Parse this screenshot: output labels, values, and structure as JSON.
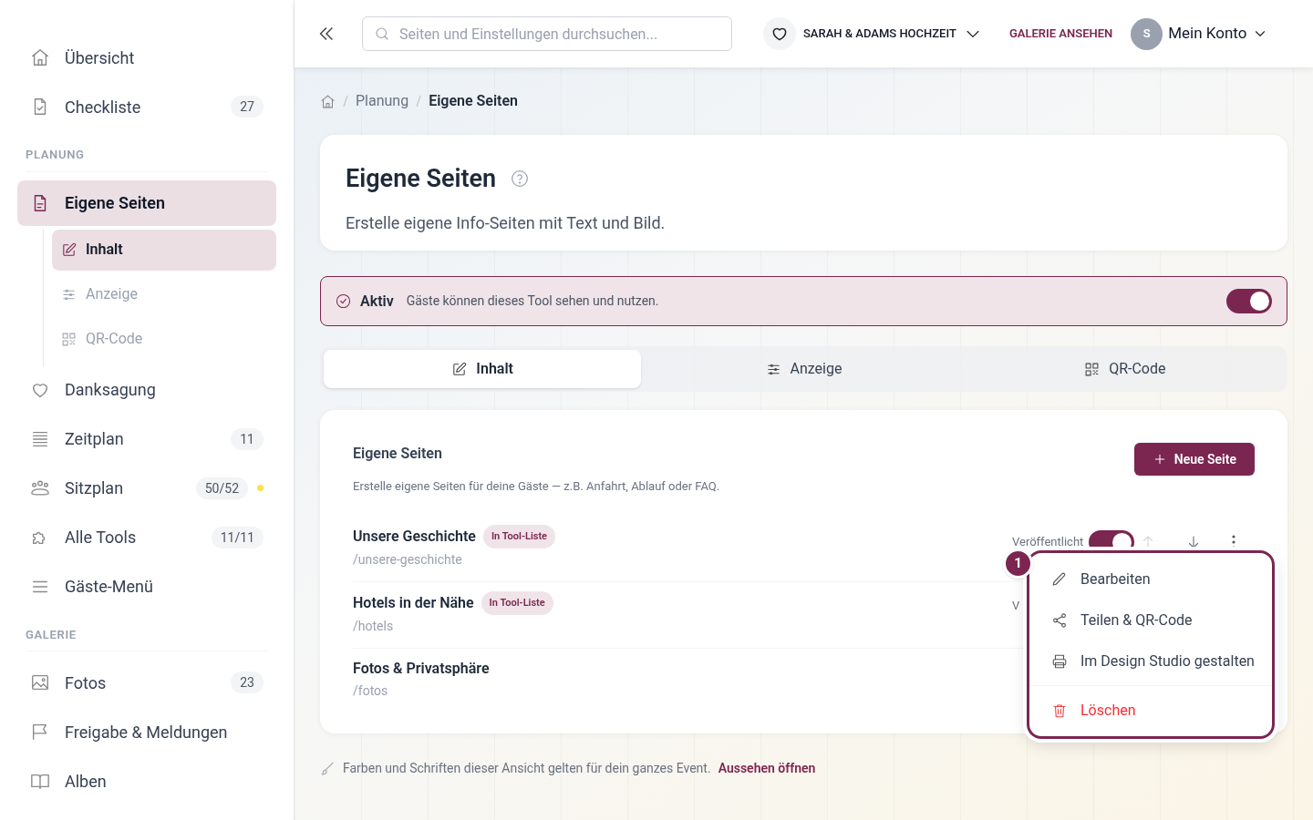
{
  "sidebar": {
    "groups": [
      {
        "items": [
          {
            "label": "Übersicht",
            "selected": false
          },
          {
            "label": "Checkliste",
            "selected": false,
            "count": "27"
          }
        ]
      },
      {
        "heading": "PLANUNG",
        "items": [
          {
            "label": "Eigene Seiten",
            "selected": true,
            "children": [
              {
                "label": "Inhalt",
                "selected": true
              },
              {
                "label": "Anzeige",
                "selected": false
              },
              {
                "label": "QR-Code",
                "selected": false
              }
            ]
          },
          {
            "label": "Danksagung",
            "selected": false
          },
          {
            "label": "Zeitplan",
            "selected": false,
            "count": "11"
          },
          {
            "label": "Sitzplan",
            "selected": false,
            "count": "50/52",
            "color": "#fde047"
          },
          {
            "label": "Alle Tools",
            "selected": false,
            "count": "11/11"
          },
          {
            "label": "Gäste-Menü",
            "selected": false
          }
        ]
      },
      {
        "heading": "GALERIE",
        "items": [
          {
            "label": "Fotos",
            "selected": false,
            "count": "23"
          },
          {
            "label": "Freigabe & Meldungen",
            "selected": false
          },
          {
            "label": "Alben",
            "selected": false
          }
        ]
      }
    ]
  },
  "header": {
    "search": {
      "placeholder": "Seiten und Einstellungen durchsuchen..."
    },
    "event": "SARAH & ADAMS HOCHZEIT",
    "gallery_link": "GALERIE ANSEHEN",
    "avatar": "S",
    "account": "Mein Konto"
  },
  "breadcrumb": [
    "Planung",
    "Eigene Seiten"
  ],
  "page": {
    "title": "Eigene Seiten",
    "description": "Erstelle eigene Info-Seiten mit Text und Bild."
  },
  "status_banner": {
    "label": "Aktiv",
    "text": "Gäste können dieses Tool sehen und nutzen.",
    "on": true
  },
  "tabs": [
    {
      "label": "Inhalt",
      "selected": true
    },
    {
      "label": "Anzeige",
      "selected": false
    },
    {
      "label": "QR-Code",
      "selected": false
    }
  ],
  "section": {
    "title": "Eigene Seiten",
    "description": "Erstelle eigene Seiten für deine Gäste — z.B. Anfahrt, Ablauf oder FAQ.",
    "button": "Neue Seite"
  },
  "pages": [
    {
      "title": "Unsere Geschichte",
      "badge": "In Tool-Liste",
      "slug": "/unsere-geschichte",
      "status_label": "Veröffentlicht",
      "published": true,
      "up_disabled": true
    },
    {
      "title": "Hotels in der Nähe",
      "badge": "In Tool-Liste",
      "slug": "/hotels",
      "status_label": "V"
    },
    {
      "title": "Fotos & Privatsphäre",
      "slug": "/fotos"
    }
  ],
  "menu": {
    "step": "1",
    "items": [
      {
        "label": "Bearbeiten",
        "kind": "normal"
      },
      {
        "label": "Teilen & QR-Code",
        "kind": "normal"
      },
      {
        "label": "Im Design Studio gestalten",
        "kind": "normal"
      },
      {
        "label": "Löschen",
        "kind": "danger"
      }
    ]
  },
  "footer": {
    "text": "Farben und Schriften dieser Ansicht gelten für dein ganzes Event.",
    "link": "Aussehen öffnen"
  }
}
